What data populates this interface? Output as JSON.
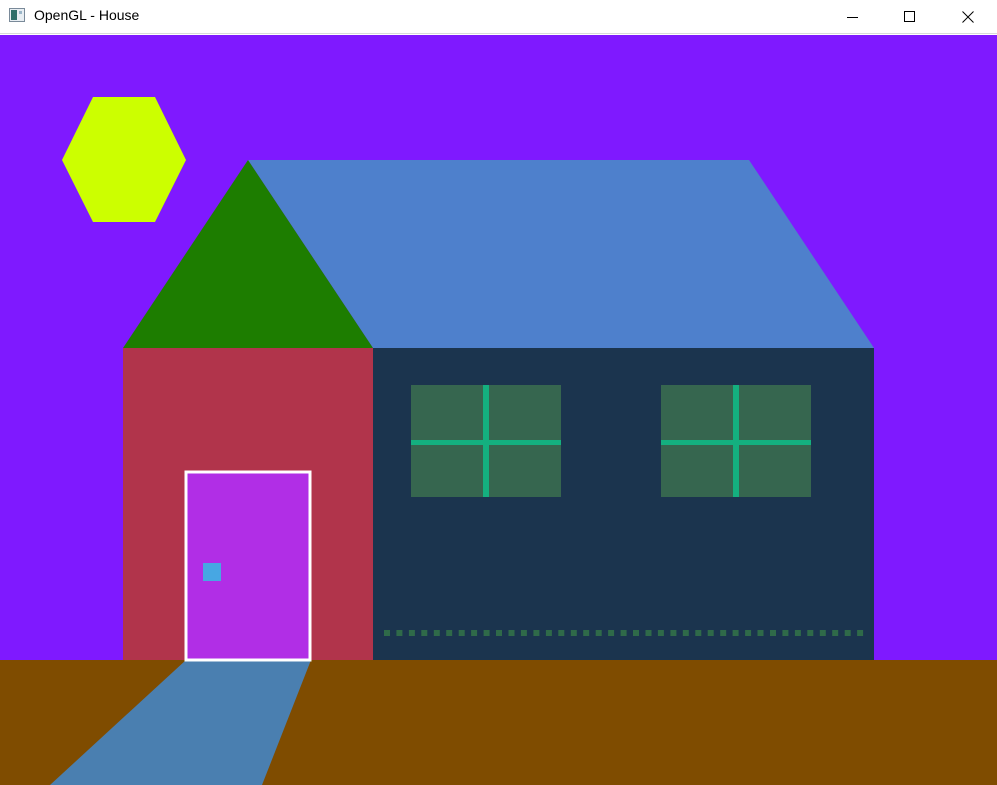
{
  "window": {
    "title": "OpenGL - House",
    "icon": "opengl-app-icon",
    "controls": {
      "minimize_icon": "minimize-icon",
      "maximize_icon": "maximize-icon",
      "close_icon": "close-icon"
    }
  },
  "scene": {
    "colors": {
      "sky": "#7f19ff",
      "sun": "#ccff00",
      "gable": "#1d7d00",
      "roof": "#4e80cc",
      "front_wall": "#b1344b",
      "side_wall": "#1b344e",
      "window_pane": "#36664f",
      "window_frame": "#14b07f",
      "door": "#b12ee6",
      "door_outline": "#ffffff",
      "door_knob": "#47a7e3",
      "ground": "#7f4c00",
      "path": "#4a7fb0",
      "trim_dots": "#2f6a49"
    }
  }
}
